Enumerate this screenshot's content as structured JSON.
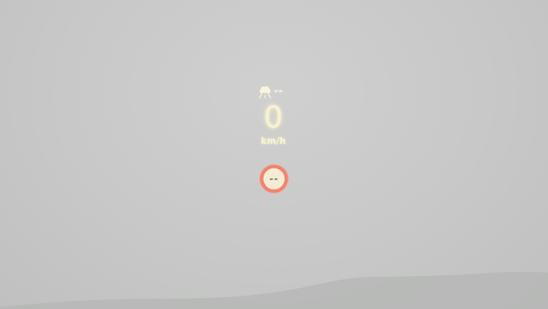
{
  "hud": {
    "lane_assist_icon": "lane-assist-icon",
    "lane_assist_status": "--",
    "speed": "0",
    "speed_unit": "km/h",
    "speed_limit_icon": "speed-limit-sign-icon",
    "speed_limit_value": "--"
  },
  "colors": {
    "hud_text": "#f7f2cf",
    "sign_ring": "#f2846e",
    "sign_fill": "#f6ecd6",
    "fog": "#c8c9c8"
  }
}
